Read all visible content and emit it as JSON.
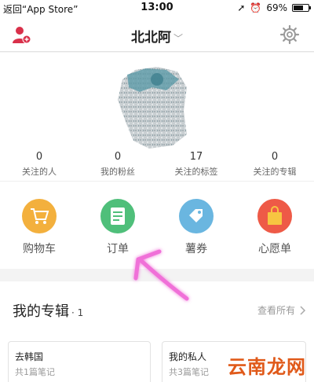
{
  "statusbar": {
    "back": "返回“App Store”",
    "time": "13:00",
    "battery": "69%",
    "battery_level": 0.69
  },
  "navbar": {
    "title": "北北阿",
    "caret": "﹀",
    "left_icon": "user-add-icon",
    "right_icon": "gear-icon"
  },
  "stats": [
    {
      "num": "0",
      "label": "关注的人"
    },
    {
      "num": "0",
      "label": "我的粉丝"
    },
    {
      "num": "17",
      "label": "关注的标签"
    },
    {
      "num": "0",
      "label": "关注的专辑"
    }
  ],
  "shortcuts": [
    {
      "label": "购物车",
      "icon": "cart-icon",
      "color": "#f3b03d"
    },
    {
      "label": "订单",
      "icon": "order-icon",
      "color": "#4fbf7a"
    },
    {
      "label": "薯券",
      "icon": "coupon-icon",
      "color": "#6ab6e0"
    },
    {
      "label": "心愿单",
      "icon": "wishlist-icon",
      "color": "#ee5a47"
    }
  ],
  "albums": {
    "heading": "我的专辑",
    "count": "· 1",
    "view_all": "查看所有",
    "cards": [
      {
        "name": "去韩国",
        "sub": "共1篇笔记"
      },
      {
        "name": "我的私人",
        "sub": "共3篇笔记"
      }
    ]
  },
  "watermark": "云南龙网",
  "colors": {
    "accent": "#d9304a",
    "arrow": "#f06fd8"
  }
}
